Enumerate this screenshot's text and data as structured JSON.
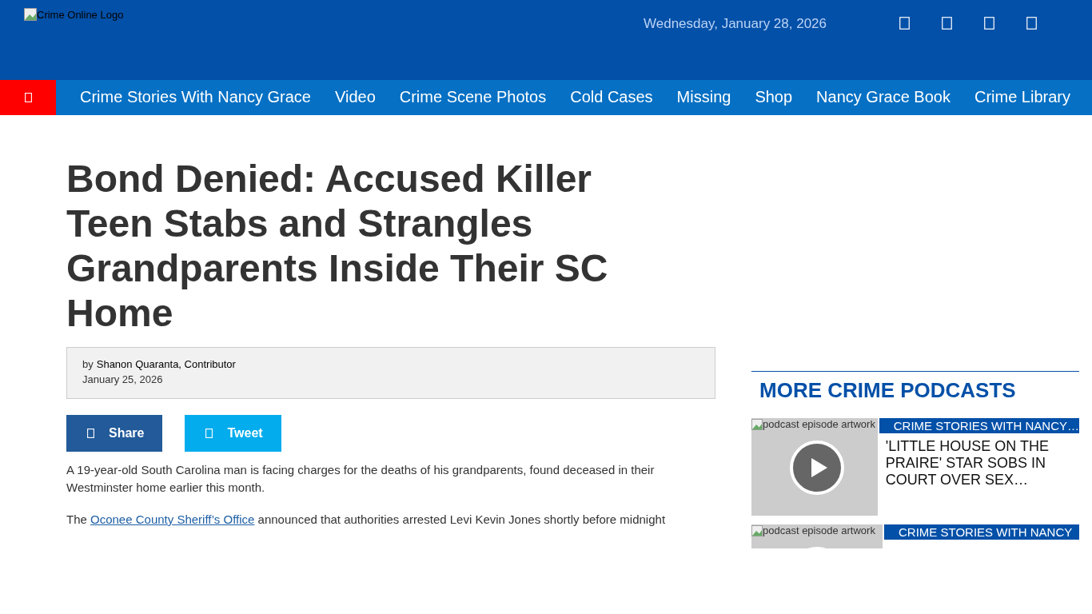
{
  "header": {
    "logo_alt": "Crime Online Logo",
    "date": "Wednesday, January 28, 2026"
  },
  "nav": {
    "items": [
      {
        "label": "Crime Stories With Nancy Grace"
      },
      {
        "label": "Video"
      },
      {
        "label": "Crime Scene Photos"
      },
      {
        "label": "Cold Cases"
      },
      {
        "label": "Missing"
      },
      {
        "label": "Shop"
      },
      {
        "label": "Nancy Grace Book"
      },
      {
        "label": "Crime Library"
      }
    ]
  },
  "article": {
    "title": "Bond Denied: Accused Killer Teen Stabs and Strangles Grandparents Inside Their SC Home",
    "byline_prefix": "by",
    "author": "Shanon Quaranta, Contributor",
    "date": "January 25, 2026",
    "share_buttons": [
      {
        "kind": "facebook",
        "label": "Share"
      },
      {
        "kind": "twitter",
        "label": "Tweet"
      }
    ],
    "paragraphs": [
      {
        "before": "A 19-year-old South Carolina man is facing charges for the deaths of his grandparents, found deceased in their Westminster home earlier this month."
      },
      {
        "before": "The ",
        "link": "Oconee County Sheriff’s Office",
        "after": " announced that authorities arrested Levi Kevin Jones shortly before midnight"
      }
    ]
  },
  "sidebar": {
    "title": "MORE CRIME PODCASTS",
    "podcasts": [
      {
        "image_alt": "podcast episode artwork",
        "show": "CRIME STORIES WITH NANCY…",
        "headline": "'LITTLE HOUSE ON THE PRAIRE' STAR SOBS IN COURT OVER SEX…"
      },
      {
        "image_alt": "podcast episode artwork",
        "show": "CRIME STORIES WITH NANCY"
      }
    ]
  }
}
